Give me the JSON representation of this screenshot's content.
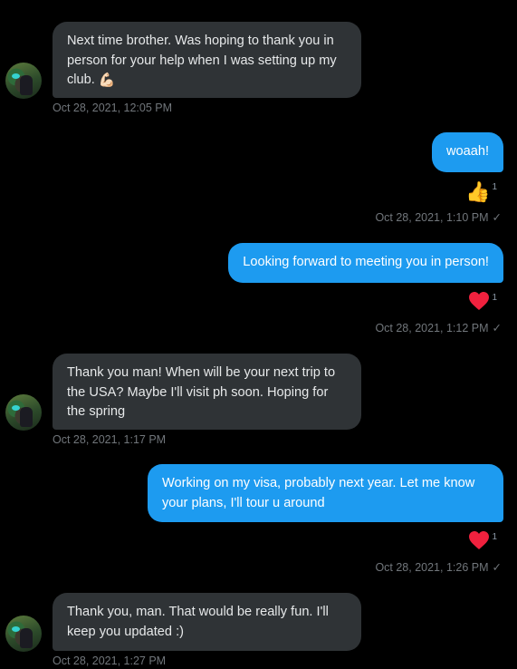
{
  "messages": [
    {
      "text": "Next time brother. Was hoping to thank you in person for your help when I was setting up my club.",
      "emoji": "💪🏻",
      "time": "Oct 28, 2021, 12:05 PM"
    },
    {
      "text": "woaah!",
      "reaction": "👍",
      "reaction_count": "1",
      "time": "Oct 28, 2021, 1:10 PM"
    },
    {
      "text": "Looking forward to meeting you in person!",
      "reaction": "heart",
      "reaction_count": "1",
      "time": "Oct 28, 2021, 1:12 PM"
    },
    {
      "text": "Thank you man! When will be your next trip to the USA? Maybe I'll visit ph soon. Hoping for the spring",
      "time": "Oct 28, 2021, 1:17 PM"
    },
    {
      "text": "Working on my visa, probably next year. Let me know your plans, I'll tour u around",
      "reaction": "heart",
      "reaction_count": "1",
      "time": "Oct 28, 2021, 1:26 PM"
    },
    {
      "text": "Thank you, man. That would be really fun. I'll keep you updated :)",
      "time": "Oct 28, 2021, 1:27 PM"
    }
  ],
  "colors": {
    "background": "#000000",
    "received_bubble": "#2f3336",
    "sent_bubble": "#1d9bf0",
    "timestamp": "#71767b",
    "heart": "#f91880"
  },
  "icons": {
    "read_check": "✓"
  }
}
